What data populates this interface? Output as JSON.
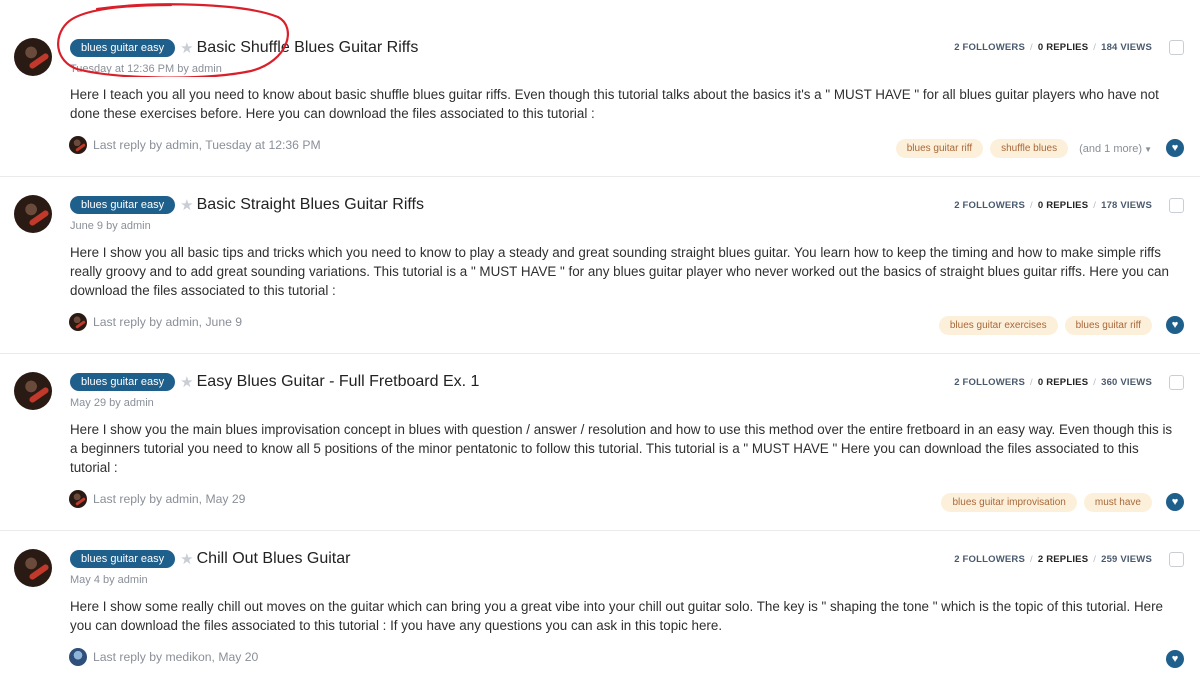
{
  "topics": [
    {
      "category": "blues guitar easy",
      "title": "Basic Shuffle Blues Guitar Riffs",
      "meta": "Tuesday at 12:36 PM by admin",
      "followers": "2 FOLLOWERS",
      "replies": "0 REPLIES",
      "views": "184 VIEWS",
      "excerpt": "Here I teach you all you need to know about basic shuffle blues guitar riffs. Even though this tutorial talks about the basics it's a \" MUST HAVE \" for all blues guitar players who have not done these exercises before. Here you can download the files associated to this tutorial :",
      "last_reply": "Last reply by admin, Tuesday at 12:36 PM",
      "tags": [
        "blues guitar riff",
        "shuffle blues"
      ],
      "more_tags": "(and 1 more)"
    },
    {
      "category": "blues guitar easy",
      "title": "Basic Straight Blues Guitar Riffs",
      "meta": "June 9 by admin",
      "followers": "2 FOLLOWERS",
      "replies": "0 REPLIES",
      "views": "178 VIEWS",
      "excerpt": "Here I show you all basic tips and tricks which you need to know to play a steady and great sounding straight blues guitar. You learn how to keep the timing and how to make simple riffs really groovy and to add great sounding variations. This tutorial is a \" MUST HAVE \" for any blues guitar player who never worked out the basics of straight blues guitar riffs. Here you can download the files associated to this tutorial :",
      "last_reply": "Last reply by admin, June 9",
      "tags": [
        "blues guitar exercises",
        "blues guitar riff"
      ]
    },
    {
      "category": "blues guitar easy",
      "title": "Easy Blues Guitar - Full Fretboard Ex. 1",
      "meta": "May 29 by admin",
      "followers": "2 FOLLOWERS",
      "replies": "0 REPLIES",
      "views": "360 VIEWS",
      "excerpt": "Here I show you the main blues improvisation concept in blues with question / answer / resolution and how to use this method over the entire fretboard in an easy way. Even though this is a beginners tutorial you need to know all 5 positions of the minor pentatonic to follow this tutorial. This tutorial is a \" MUST HAVE \" Here you can download the files associated to this tutorial :",
      "last_reply": "Last reply by admin, May 29",
      "tags": [
        "blues guitar improvisation",
        "must have"
      ]
    },
    {
      "category": "blues guitar easy",
      "title": "Chill Out Blues Guitar",
      "meta": "May 4 by admin",
      "followers": "2 FOLLOWERS",
      "replies": "2 REPLIES",
      "views": "259 VIEWS",
      "excerpt": "Here I show some really chill out moves on the guitar which can bring you a great vibe into your chill out guitar solo. The key is \" shaping the tone \" which is the topic of this tutorial. Here you can download the files associated to this tutorial : If you have any questions you can ask in this topic here.",
      "last_reply": "Last reply by medikon, May 20",
      "tags": []
    }
  ],
  "colors": {
    "badge": "#1f5f8b",
    "tag_bg": "#fdf0da",
    "tag_text": "#a8683a",
    "annotation": "#d9202a"
  },
  "icons": {
    "favorite": "star-icon",
    "follow": "heart-icon",
    "more": "caret-down-icon"
  }
}
